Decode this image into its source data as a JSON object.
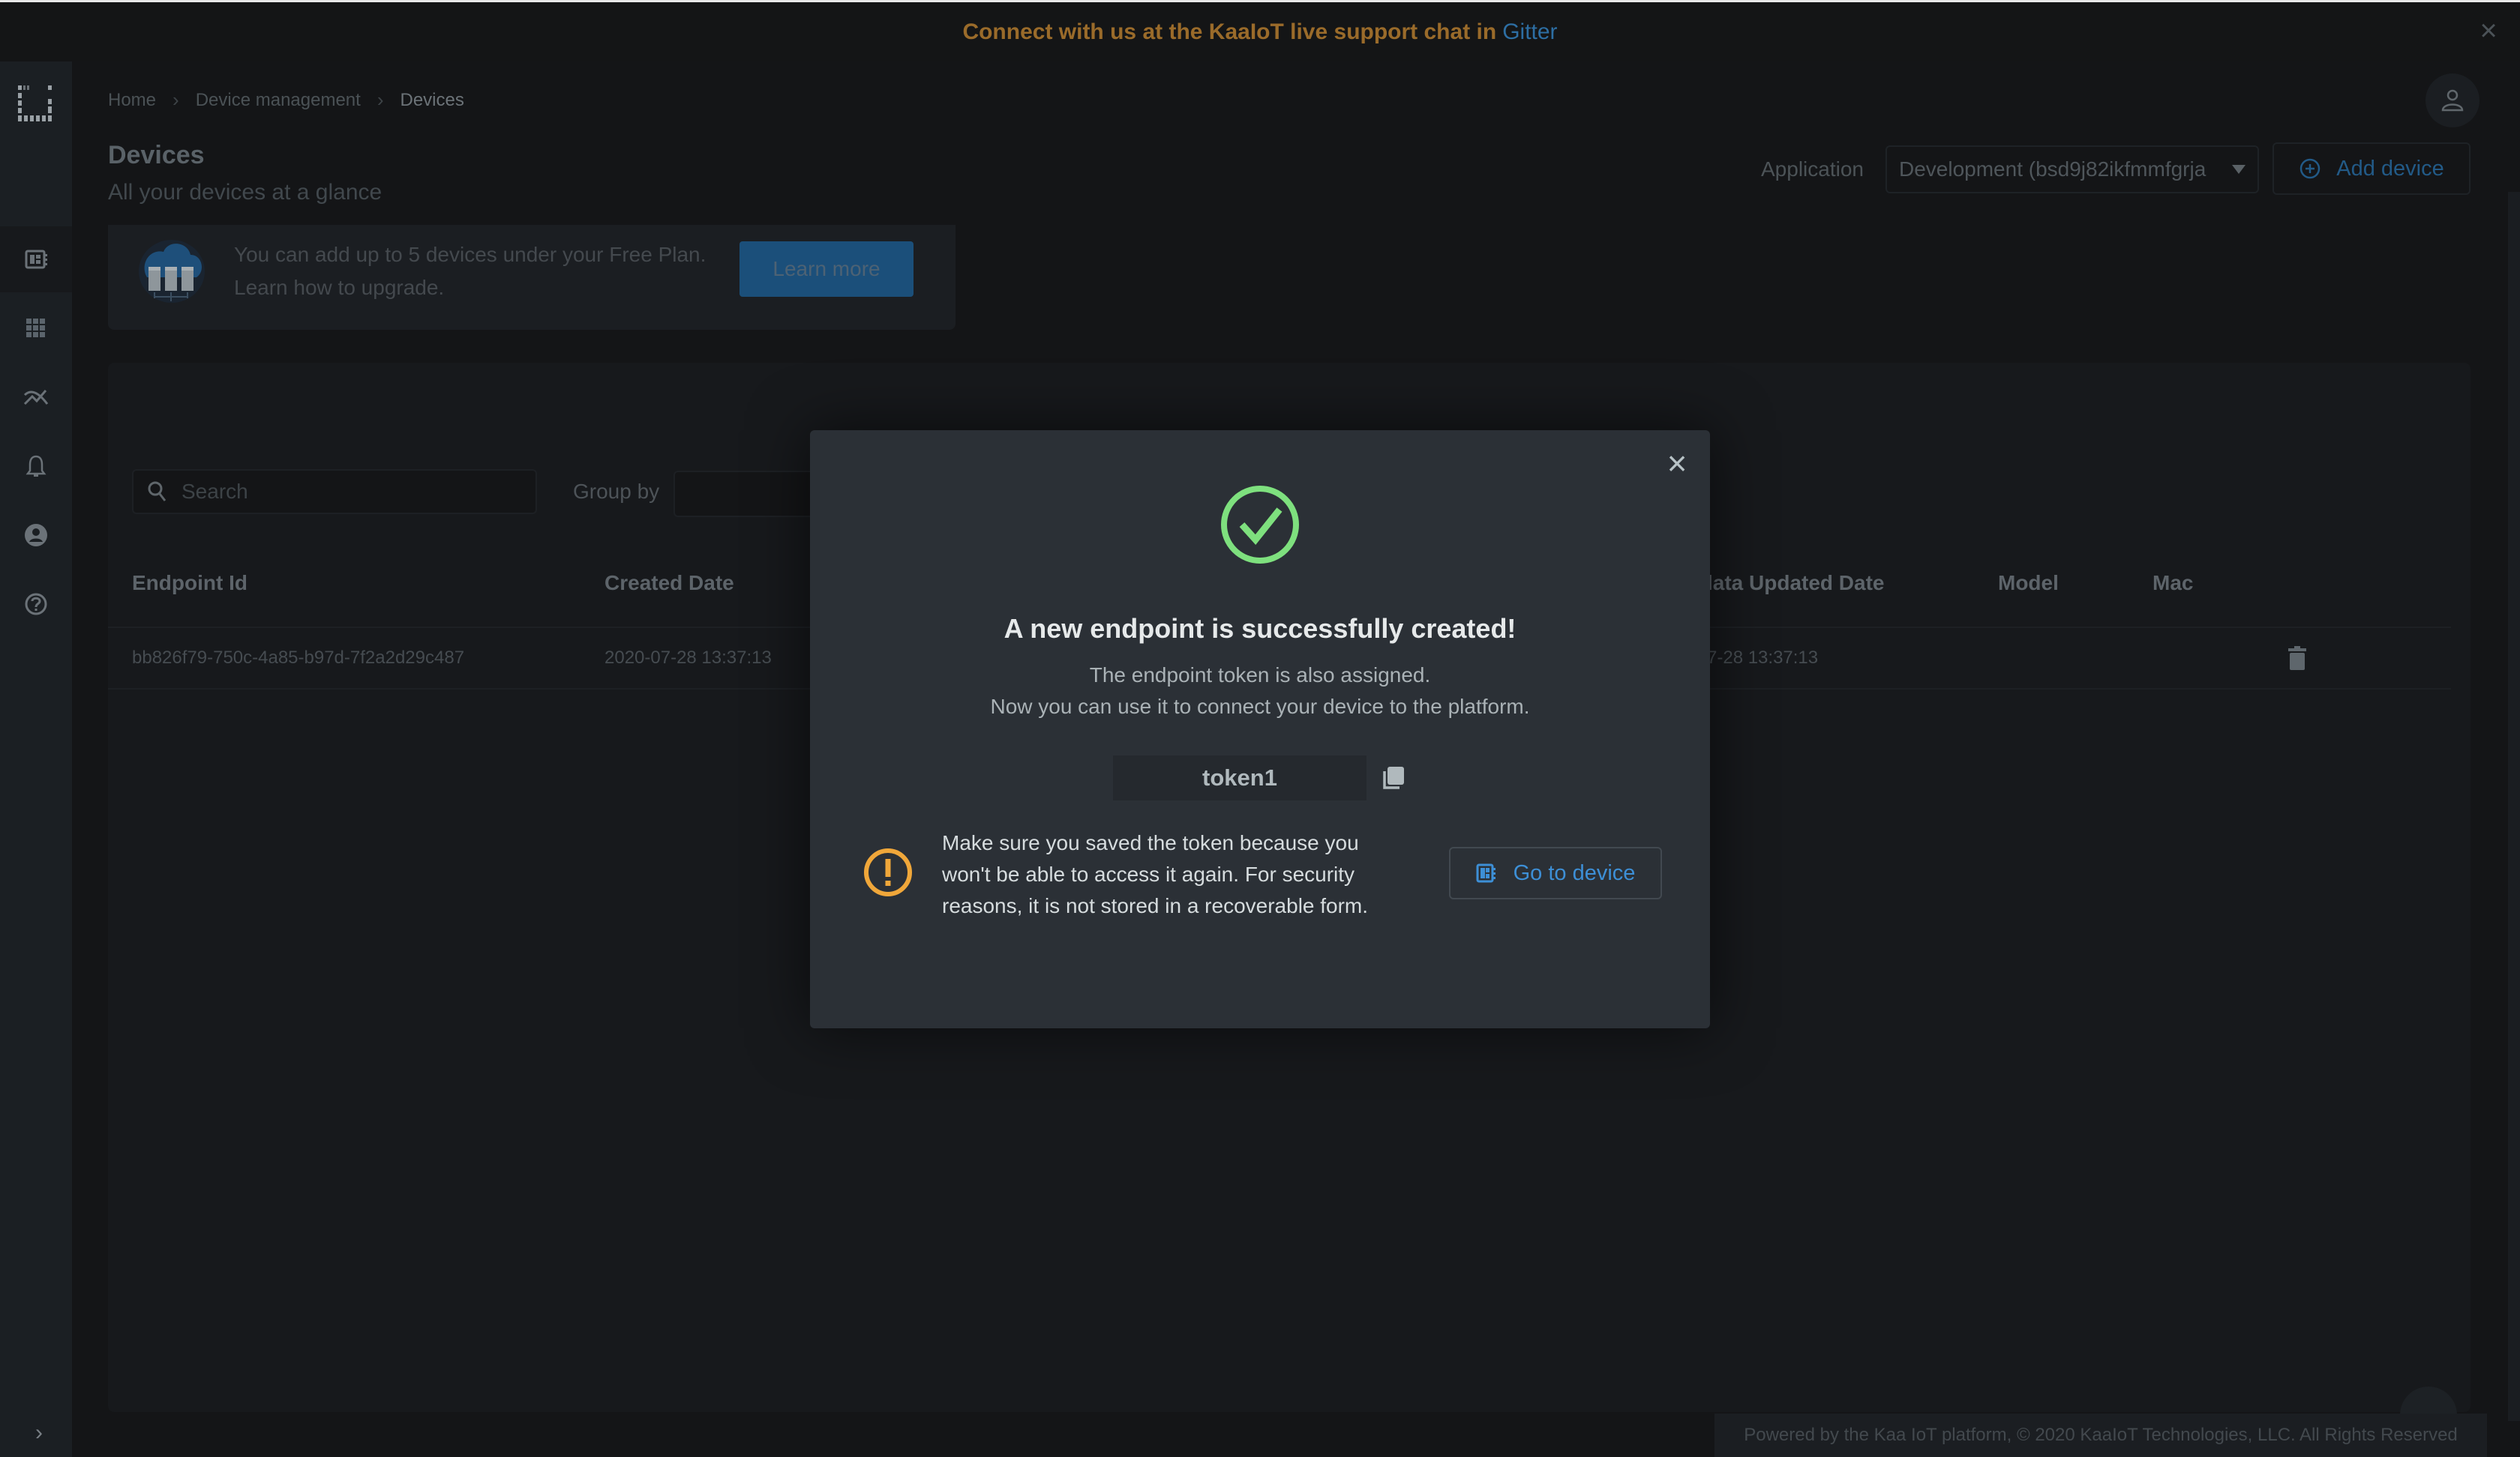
{
  "banner": {
    "text": "Connect with us at the KaaIoT live support chat in",
    "link": "Gitter",
    "close_icon": "close-icon"
  },
  "sidebar": {
    "logo": "kaa-logo",
    "items": [
      {
        "icon": "device-dashboard-icon",
        "label": "Device management",
        "active": true
      },
      {
        "icon": "apps-grid-icon",
        "label": "Applications"
      },
      {
        "icon": "analytics-icon",
        "label": "Analytics"
      },
      {
        "icon": "bell-icon",
        "label": "Notifications"
      },
      {
        "icon": "user-circle-icon",
        "label": "Users"
      },
      {
        "icon": "help-icon",
        "label": "Help"
      }
    ],
    "expand_icon": "chevron-right-icon"
  },
  "breadcrumb": [
    "Home",
    "Device management",
    "Devices"
  ],
  "header": {
    "title": "Devices",
    "subtitle": "All your devices at a glance",
    "application_label": "Application",
    "application_value": "Development (bsd9j82ikfmmfgrja",
    "add_device_label": "Add device"
  },
  "plan_card": {
    "line1": "You can add up to 5 devices under your Free Plan.",
    "line2": "Learn how to upgrade.",
    "button": "Learn more"
  },
  "filters": {
    "search_placeholder": "Search",
    "search_value": "",
    "group_by_label": "Group by",
    "group_by_value": ""
  },
  "table": {
    "columns": [
      "Endpoint Id",
      "Created Date",
      "lata Updated Date",
      "Model",
      "Mac"
    ],
    "rows": [
      {
        "endpoint_id": "bb826f79-750c-4a85-b97d-7f2a2d29c487",
        "created_date": "2020-07-28 13:37:13",
        "updated_date": "7-28 13:37:13",
        "model": "",
        "mac": ""
      }
    ]
  },
  "modal": {
    "title": "A new endpoint is successfully created!",
    "subtitle_line1": "The endpoint token is also assigned.",
    "subtitle_line2": "Now you can use it to connect your device to the platform.",
    "token": "token1",
    "warning": "Make sure you saved the token because you won't be able to access it again. For security reasons, it is not stored in a recoverable form.",
    "go_to_device_label": "Go to device",
    "colors": {
      "success": "#7ee07e",
      "warning": "#f0a73a",
      "link": "#3d8fd6"
    }
  },
  "footer": {
    "text": "Powered by the Kaa IoT platform, © 2020 KaaIoT Technologies, LLC. All Rights Reserved"
  }
}
